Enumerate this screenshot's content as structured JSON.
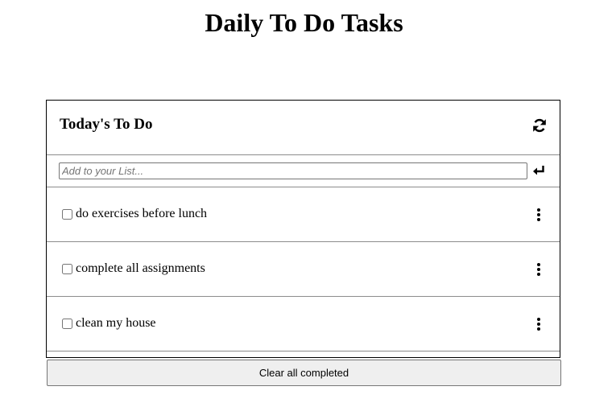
{
  "page": {
    "title": "Daily To Do Tasks"
  },
  "card": {
    "title": "Today's To Do",
    "refresh_icon": "refresh-icon",
    "add_input": {
      "value": "",
      "placeholder": "Add to your List..."
    },
    "enter_icon": "enter-arrow-icon"
  },
  "tasks": [
    {
      "label": "do exercises before lunch",
      "checked": false
    },
    {
      "label": "complete all assignments",
      "checked": false
    },
    {
      "label": "clean my house",
      "checked": false
    }
  ],
  "menu_icon": "vertical-ellipsis-icon",
  "footer": {
    "clear_label": "Clear all completed"
  }
}
